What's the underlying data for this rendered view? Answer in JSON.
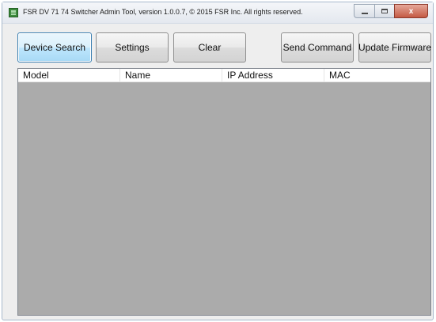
{
  "window": {
    "title": "FSR DV 71 74 Switcher Admin Tool, version 1.0.0.7, © 2015 FSR Inc. All rights reserved.",
    "icon": "app-icon",
    "controls": {
      "minimize": "minimize-icon",
      "maximize": "maximize-icon",
      "close_label": "x"
    }
  },
  "toolbar": {
    "device_search_label": "Device Search",
    "settings_label": "Settings",
    "clear_label": "Clear",
    "send_command_label": "Send Command",
    "update_firmware_label": "Update Firmware"
  },
  "device_list": {
    "columns": [
      "Model",
      "Name",
      "IP Address",
      "MAC"
    ],
    "rows": []
  },
  "colors": {
    "list_background": "#ababab",
    "focused_button": "#bee6fd",
    "close_button": "#c45a44"
  }
}
